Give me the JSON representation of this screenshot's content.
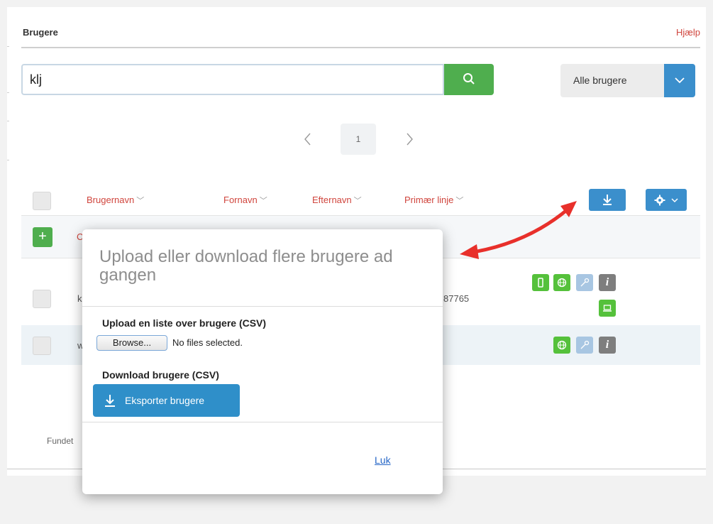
{
  "header": {
    "title": "Brugere",
    "help": "Hjælp"
  },
  "search": {
    "value": "klj",
    "button_icon": "search-icon"
  },
  "filter": {
    "selected": "Alle brugere",
    "toggle_icon": "chevron-down-icon"
  },
  "pagination": {
    "current_page": "1",
    "prev_icon": "chevron-left-icon",
    "next_icon": "chevron-right-icon"
  },
  "table": {
    "columns": [
      "Brugernavn",
      "Fornavn",
      "Efternavn",
      "Primær linje"
    ],
    "download_icon": "download-icon",
    "settings_icon": "gear-icon",
    "add_row_fragment": "C",
    "rows": [
      {
        "username_fragment": "k",
        "line_fragment": "87765"
      },
      {
        "username_fragment": "w"
      }
    ]
  },
  "footer": {
    "found_fragment": "Fundet"
  },
  "modal": {
    "title": "Upload eller download flere brugere ad gangen",
    "upload_label": "Upload en liste over brugere (CSV)",
    "browse_label": "Browse...",
    "file_status": "No files selected.",
    "download_label": "Download brugere (CSV)",
    "export_label": "Eksporter brugere",
    "close_label": "Luk"
  },
  "colors": {
    "accent_red": "#d0453d",
    "primary_blue": "#3b8fcc",
    "success_green": "#4fae4e",
    "status_green": "#55c13b",
    "annotation_arrow": "#e8302b"
  }
}
